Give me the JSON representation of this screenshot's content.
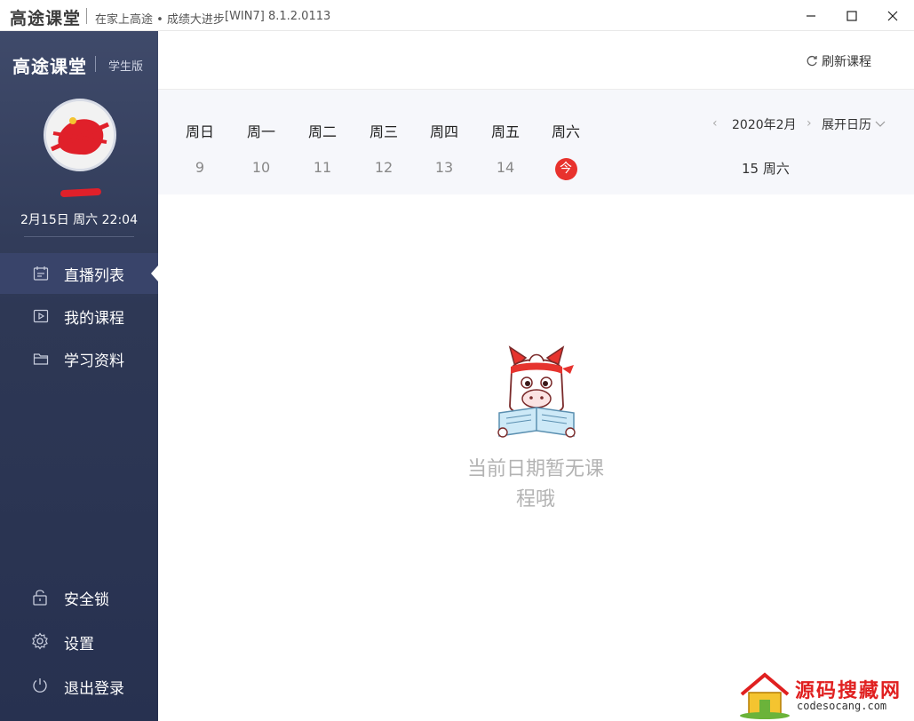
{
  "titlebar": {
    "logo": "高途课堂",
    "slogan": "在家上高途 • 成绩大进步",
    "version": "[WIN7] 8.1.2.0113"
  },
  "sidebar": {
    "brand": "高途课堂",
    "edition": "学生版",
    "datetime": "2月15日 周六 22:04",
    "nav": [
      {
        "label": "直播列表",
        "icon": "calendar-icon",
        "active": true
      },
      {
        "label": "我的课程",
        "icon": "video-icon",
        "active": false
      },
      {
        "label": "学习资料",
        "icon": "folder-icon",
        "active": false
      }
    ],
    "footer": [
      {
        "label": "安全锁",
        "icon": "lock-icon"
      },
      {
        "label": "设置",
        "icon": "gear-icon"
      },
      {
        "label": "退出登录",
        "icon": "power-icon"
      }
    ]
  },
  "main": {
    "refresh_label": "刷新课程",
    "week": [
      {
        "weekday": "周日",
        "date": "9"
      },
      {
        "weekday": "周一",
        "date": "10"
      },
      {
        "weekday": "周二",
        "date": "11"
      },
      {
        "weekday": "周三",
        "date": "12"
      },
      {
        "weekday": "周四",
        "date": "13"
      },
      {
        "weekday": "周五",
        "date": "14"
      },
      {
        "weekday": "周六",
        "date": "今"
      }
    ],
    "month": "2020年2月",
    "expand_label": "展开日历",
    "selected_date": "15 周六",
    "empty_line1": "当前日期暂无课",
    "empty_line2": "程哦"
  },
  "watermark": {
    "title": "源码搜藏网",
    "url": "codesocang.com"
  },
  "colors": {
    "sidebar": "#2e3855",
    "today": "#e8322d",
    "calendar_bg": "#f6f7fb"
  }
}
